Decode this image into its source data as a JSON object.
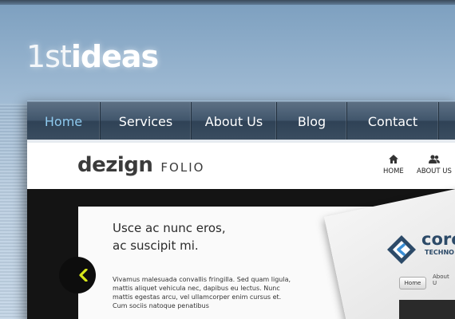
{
  "logo": {
    "part1": "1st",
    "part2": "ideas"
  },
  "nav": {
    "items": [
      {
        "label": "Home",
        "active": true
      },
      {
        "label": "Services",
        "active": false
      },
      {
        "label": "About Us",
        "active": false
      },
      {
        "label": "Blog",
        "active": false
      },
      {
        "label": "Contact",
        "active": false
      }
    ]
  },
  "preview": {
    "brand_dezign": "dezign",
    "brand_folio": "FOLIO",
    "mini_nav": [
      {
        "label": "HOME",
        "icon": "home-icon"
      },
      {
        "label": "ABOUT US",
        "icon": "users-icon"
      }
    ],
    "heading_line1": "Usce ac nunc eros,",
    "heading_line2": "ac suscipit mi.",
    "body_text": "Vivamus malesuada convallis fringilla. Sed quam ligula, mattis aliquet vehicula nec, dapibus eu lectus. Nunc mattis egestas arcu, vel ullamcorper enim cursus et. Cum sociis natoque penatibus",
    "slider_arrow_icon": "chevron-left-icon",
    "mockup": {
      "logo_text": "core",
      "logo_sub": "TECHNO",
      "home_button": "Home",
      "about_label": "About U"
    }
  },
  "colors": {
    "nav_active": "#8ec9ee",
    "slider_arrow": "#d6e61a",
    "brand_dark": "#3b3b3b"
  }
}
